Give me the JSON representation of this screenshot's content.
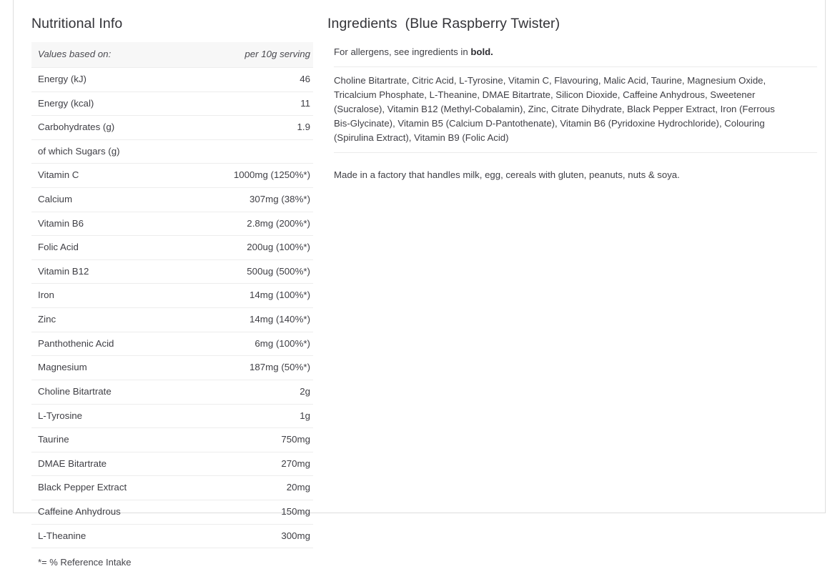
{
  "nutrition": {
    "title": "Nutritional Info",
    "header": {
      "label": "Values based on:",
      "value": "per 10g serving"
    },
    "rows": [
      {
        "name": "Energy (kJ)",
        "value": "46"
      },
      {
        "name": "Energy (kcal)",
        "value": "11"
      },
      {
        "name": "Carbohydrates (g)",
        "value": "1.9"
      },
      {
        "name": "of which Sugars (g)",
        "value": ""
      },
      {
        "name": "Vitamin C",
        "value": "1000mg (1250%*)"
      },
      {
        "name": "Calcium",
        "value": "307mg (38%*)"
      },
      {
        "name": "Vitamin B6",
        "value": "2.8mg (200%*)"
      },
      {
        "name": "Folic Acid",
        "value": "200ug (100%*)"
      },
      {
        "name": "Vitamin B12",
        "value": "500ug (500%*)"
      },
      {
        "name": "Iron",
        "value": "14mg (100%*)"
      },
      {
        "name": "Zinc",
        "value": "14mg (140%*)"
      },
      {
        "name": "Panthothenic Acid",
        "value": "6mg (100%*)"
      },
      {
        "name": "Magnesium",
        "value": "187mg (50%*)"
      },
      {
        "name": "Choline Bitartrate",
        "value": "2g"
      },
      {
        "name": "L-Tyrosine",
        "value": "1g"
      },
      {
        "name": "Taurine",
        "value": "750mg"
      },
      {
        "name": "DMAE Bitartrate",
        "value": "270mg"
      },
      {
        "name": "Black Pepper Extract",
        "value": "20mg"
      },
      {
        "name": "Caffeine Anhydrous",
        "value": "150mg"
      },
      {
        "name": "L-Theanine",
        "value": "300mg"
      }
    ],
    "footnote": "*= % Reference Intake"
  },
  "ingredients": {
    "title": "Ingredients",
    "variant": "(Blue Raspberry Twister)",
    "allergen_note_prefix": "For allergens, see ingredients in ",
    "allergen_note_bold": "bold.",
    "list": "Choline Bitartrate, Citric Acid, L-Tyrosine, Vitamin C, Flavouring, Malic Acid, Taurine, Magnesium Oxide, Tricalcium Phosphate, L-Theanine, DMAE Bitartrate, Silicon Dioxide, Caffeine Anhydrous, Sweetener (Sucralose), Vitamin B12 (Methyl-Cobalamin), Zinc, Citrate Dihydrate, Black Pepper Extract, Iron (Ferrous Bis-Glycinate), Vitamin B5 (Calcium D-Pantothenate), Vitamin B6 (Pyridoxine Hydrochloride), Colouring (Spirulina Extract), Vitamin B9 (Folic Acid)",
    "factory_note": "Made in a factory that handles milk, egg, cereals with gluten, peanuts, nuts & soya."
  },
  "colors": {
    "text": "#3f3f45",
    "heading": "#333338",
    "rule": "#ededed",
    "header_bg": "#f7f7f7",
    "panel_border": "#dedede"
  }
}
